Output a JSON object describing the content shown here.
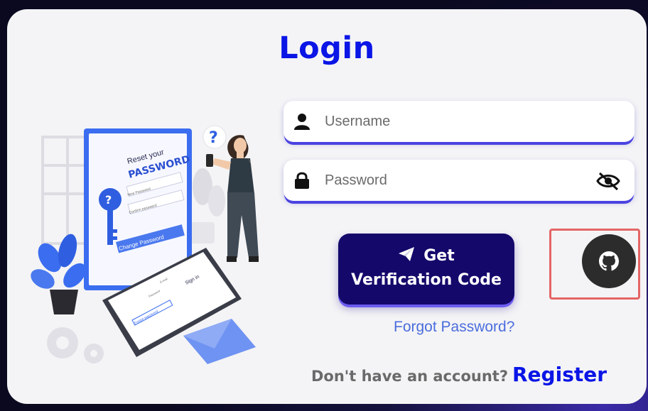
{
  "login": {
    "title": "Login",
    "username_placeholder": "Username",
    "password_placeholder": "Password",
    "verify_button_line1": "Get",
    "verify_button_line2": "Verification Code",
    "forgot_link": "Forgot Password?",
    "no_account_text": "Don't have an account?",
    "register_link": "Register"
  },
  "illustration": {
    "reset_title_small": "Reset your",
    "reset_title_big": "PASSWORD",
    "new_password_label": "New Password",
    "confirm_password_label": "Confirm password",
    "change_button": "Change Password",
    "phone_signin": "Sign in",
    "phone_email_label": "E-mail",
    "phone_password_label": "Password",
    "phone_forgot": "Forgot password"
  },
  "icons": {
    "user": "user-icon",
    "lock": "lock-icon",
    "eye_slash": "eye-slash-icon",
    "send": "paper-plane-icon",
    "github": "github-icon"
  },
  "colors": {
    "title": "#0a15e6",
    "button_bg": "#14086b",
    "link": "#4a6ddc",
    "highlight": "#e46565"
  }
}
